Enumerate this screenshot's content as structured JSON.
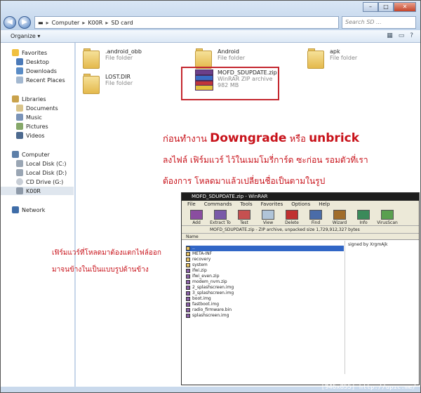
{
  "address": {
    "crumbs": [
      "Computer",
      "K00R",
      "SD card"
    ],
    "search_placeholder": "Search SD ..."
  },
  "toolbar": {
    "organize_label": "Organize ▾"
  },
  "nav": {
    "favorites": {
      "header": "Favorites",
      "items": [
        "Desktop",
        "Downloads",
        "Recent Places"
      ]
    },
    "libraries": {
      "header": "Libraries",
      "items": [
        "Documents",
        "Music",
        "Pictures",
        "Videos"
      ]
    },
    "computer": {
      "header": "Computer",
      "items": [
        "Local Disk (C:)",
        "Local Disk (D:)",
        "CD Drive (G:)",
        "K00R"
      ]
    },
    "network": {
      "header": "Network"
    }
  },
  "files": [
    {
      "name": ".android_obb",
      "type": "File folder"
    },
    {
      "name": "Android",
      "type": "File folder"
    },
    {
      "name": "apk",
      "type": "File folder"
    },
    {
      "name": "LOST.DIR",
      "type": "File folder"
    },
    {
      "name": "MOFD_SDUPDATE.zip",
      "type": "WinRAR ZIP archive",
      "size": "982 MB"
    }
  ],
  "annotation": {
    "line1_prefix": "ก่อนทำงาน ",
    "line1_word1": "Downgrade",
    "line1_mid": " หรือ ",
    "line1_word2": "unbrick",
    "line2": "ลงไฟล์ เฟิร์มแวร์ ไว้ในเมมโมรี่การ์ด ซะก่อน รอมตัวที่เรา",
    "line3": "ต้องการ โหลดมาแล้วเปลี่ยนชื่อเป็นตามในรูป",
    "side1": "เฟิร์มแวร์ที่โหลดมาต้องแตกไฟล์ออก",
    "side2": "มาจนข้างในเป็นแบบรูปด้านข้าง"
  },
  "winrar": {
    "title": "MOFD_SDUPDATE.zip - WinRAR",
    "menu": [
      "File",
      "Commands",
      "Tools",
      "Favorites",
      "Options",
      "Help"
    ],
    "tools": [
      "Add",
      "Extract To",
      "Test",
      "View",
      "Delete",
      "Find",
      "Wizard",
      "Info",
      "VirusScan"
    ],
    "path": "MOFD_SDUPDATE.zip - ZIP archive, unpacked size 1,729,912,327 bytes",
    "column_name": "Name",
    "side_text": "signed by XrgmAjk",
    "rows": [
      "..",
      "META-INF",
      "recovery",
      "system",
      "ifwi.zip",
      "ifwi_even.zip",
      "modem_nvm.zip",
      "2_splashscreen.img",
      "3_splashscreen.img",
      "boot.img",
      "fastboot.img",
      "radio_firmware.bin",
      "splashscreen.img"
    ]
  },
  "footer": "[946x855] http://upic.me/"
}
